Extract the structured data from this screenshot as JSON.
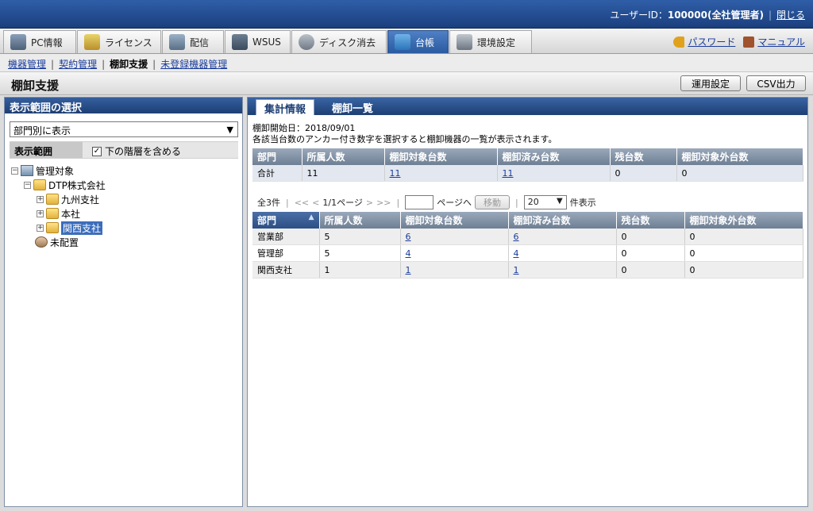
{
  "header": {
    "user_label": "ユーザーID：",
    "user_value": "100000(全社管理者)",
    "close_label": "閉じる"
  },
  "nav": {
    "tabs": [
      {
        "label": "PC情報",
        "icon": "pc-icon"
      },
      {
        "label": "ライセンス",
        "icon": "license-icon"
      },
      {
        "label": "配信",
        "icon": "distribution-icon"
      },
      {
        "label": "WSUS",
        "icon": "wsus-icon"
      },
      {
        "label": "ディスク消去",
        "icon": "disk-erase-icon"
      },
      {
        "label": "台帳",
        "icon": "ledger-icon"
      },
      {
        "label": "環境設定",
        "icon": "settings-icon"
      }
    ],
    "password_label": "パスワード",
    "manual_label": "マニュアル"
  },
  "subnav": {
    "items": [
      "機器管理",
      "契約管理",
      "棚卸支援",
      "未登録機器管理"
    ]
  },
  "page": {
    "title": "棚卸支援",
    "settings_button": "運用設定",
    "csv_button": "CSV出力"
  },
  "left": {
    "header": "表示範囲の選択",
    "select_value": "部門別に表示",
    "scope_label": "表示範囲",
    "include_label": "下の階層を含める",
    "tree": {
      "root": "管理対象",
      "company": "DTP株式会社",
      "branch1": "九州支社",
      "branch2": "本社",
      "branch3": "関西支社",
      "unassigned": "未配置"
    }
  },
  "right": {
    "tabs": [
      "集計情報",
      "棚卸一覧"
    ],
    "start_date": "棚卸開始日：2018/09/01",
    "instruction": "各該当台数のアンカー付き数字を選択すると棚卸機器の一覧が表示されます。",
    "summary": {
      "headers": [
        "部門",
        "所属人数",
        "棚卸対象台数",
        "棚卸済み台数",
        "残台数",
        "棚卸対象外台数"
      ],
      "row": [
        "合計",
        "11",
        "11",
        "11",
        "0",
        "0"
      ]
    },
    "pager": {
      "count": "全3件",
      "first": "<<",
      "prev": "<",
      "page": "1/1ページ",
      "next": ">",
      "last": ">>",
      "goto_label": "ページへ",
      "move_button": "移動",
      "per_page": "20",
      "per_page_label": "件表示"
    },
    "detail": {
      "headers": [
        "部門",
        "所属人数",
        "棚卸対象台数",
        "棚卸済み台数",
        "残台数",
        "棚卸対象外台数"
      ],
      "rows": [
        [
          "営業部",
          "5",
          "6",
          "6",
          "0",
          "0"
        ],
        [
          "管理部",
          "5",
          "4",
          "4",
          "0",
          "0"
        ],
        [
          "関西支社",
          "1",
          "1",
          "1",
          "0",
          "0"
        ]
      ]
    }
  }
}
